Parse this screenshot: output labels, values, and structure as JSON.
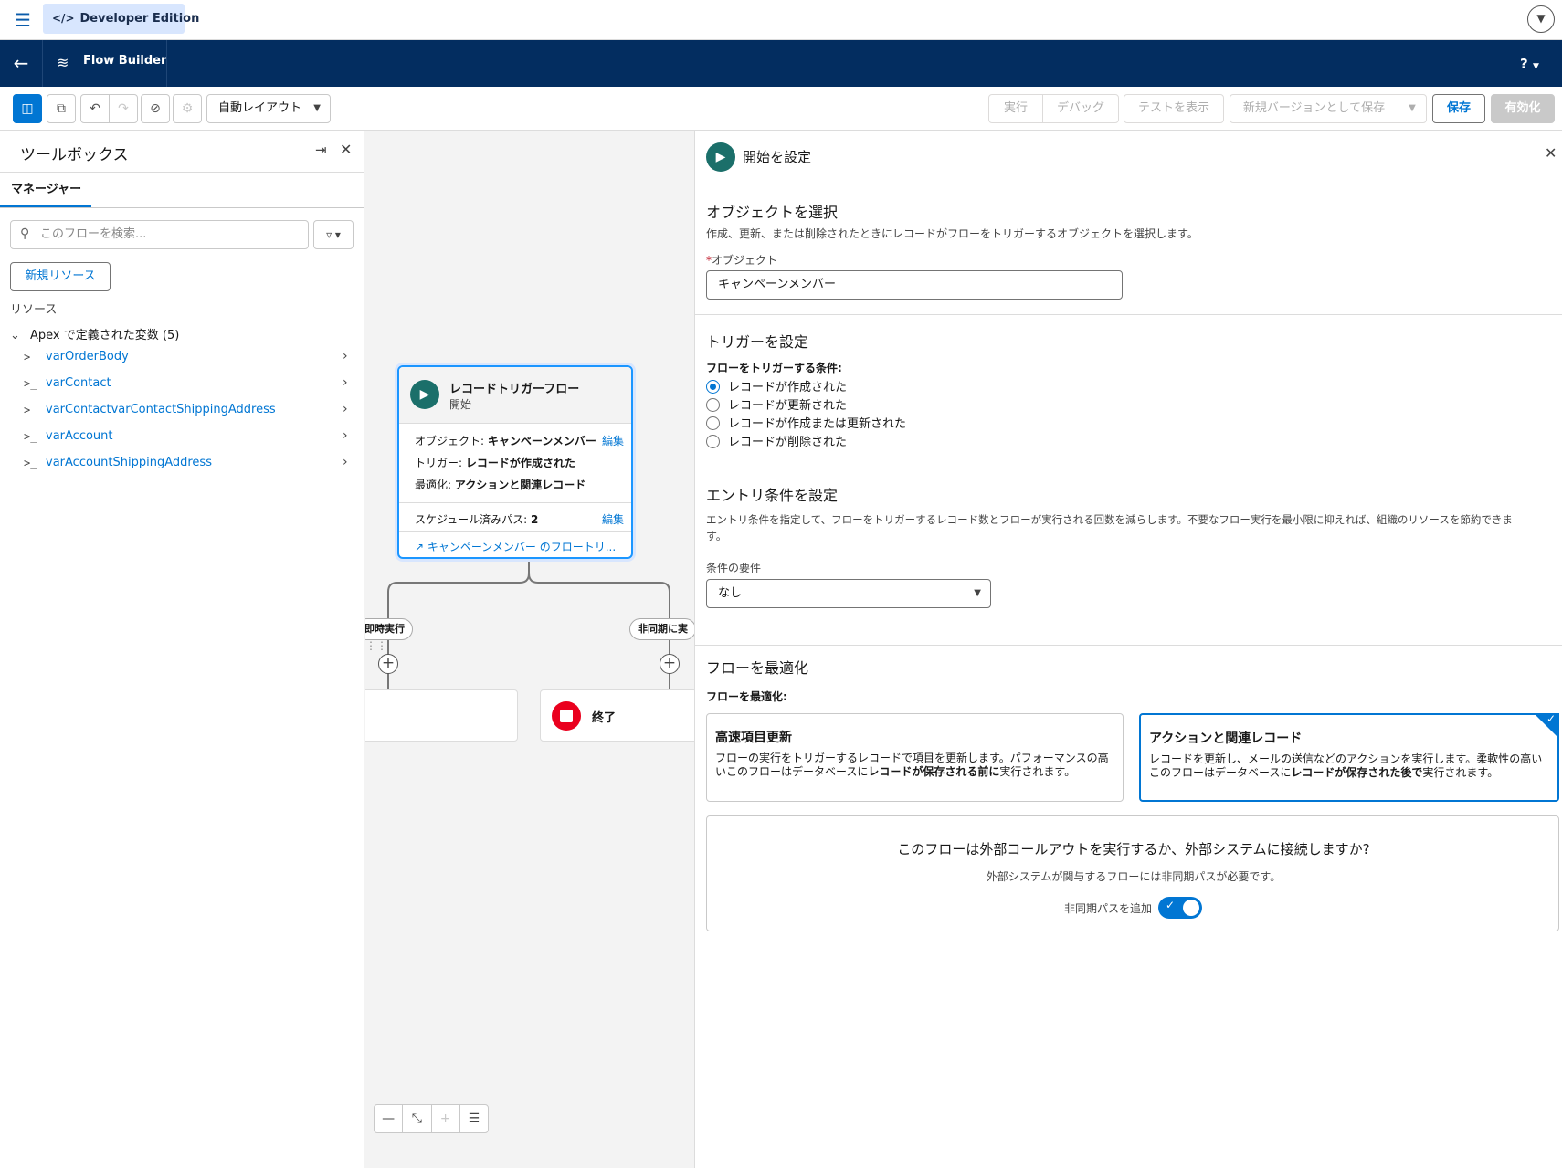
{
  "topbar": {
    "menu_icon": "hamburger-icon",
    "app_name": "Developer Edition",
    "app_icon": "code-icon",
    "user_icon": "chevron-down-icon"
  },
  "header": {
    "back_icon": "arrow-left-icon",
    "tool_icon": "flow-icon",
    "title": "Flow Builder",
    "help": "?"
  },
  "toolbar": {
    "layout_value": "自動レイアウト",
    "run": "実行",
    "debug": "デバッグ",
    "view_tests": "テストを表示",
    "save_as_new_version": "新規バージョンとして保存",
    "save": "保存",
    "activate": "有効化"
  },
  "toolbox": {
    "title": "ツールボックス",
    "tab": "マネージャー",
    "search_placeholder": "このフローを検索...",
    "new_resource": "新規リソース",
    "resources_label": "リソース",
    "group_label": "Apex で定義された変数 (5)",
    "variables": [
      {
        "name": "varOrderBody"
      },
      {
        "name": "varContact"
      },
      {
        "name": "varContactvarContactShippingAddress"
      },
      {
        "name": "varAccount"
      },
      {
        "name": "varAccountShippingAddress"
      }
    ]
  },
  "canvas": {
    "start": {
      "name": "レコードトリガーフロー",
      "sub": "開始",
      "object_label": "オブジェクト:",
      "object_value": "キャンペーンメンバー",
      "trigger_label": "トリガー:",
      "trigger_value": "レコードが作成された",
      "optimize_label": "最適化:",
      "optimize_value": "アクションと関連レコード",
      "edit": "編集",
      "scheduled_label": "スケジュール済みパス:",
      "scheduled_value": "2",
      "link": "キャンペーンメンバー のフロートリ..."
    },
    "path_immediate": "即時実行",
    "path_async": "非同期に実",
    "end_label": "終了"
  },
  "panel": {
    "title": "開始を設定",
    "object_section": {
      "title": "オブジェクトを選択",
      "desc": "作成、更新、または削除されたときにレコードがフローをトリガーするオブジェクトを選択します。",
      "field_label": "オブジェクト",
      "field_value": "キャンペーンメンバー"
    },
    "trigger_section": {
      "title": "トリガーを設定",
      "label": "フローをトリガーする条件:",
      "options": [
        {
          "label": "レコードが作成された"
        },
        {
          "label": "レコードが更新された"
        },
        {
          "label": "レコードが作成または更新された"
        },
        {
          "label": "レコードが削除された"
        }
      ],
      "selected_index": 0
    },
    "entry_section": {
      "title": "エントリ条件を設定",
      "desc_line1": "エントリ条件を指定して、フローをトリガーするレコード数とフローが実行される回数を減らします。不要なフロー実行を最小限に抑えれば、組織のリソースを節約できま",
      "desc_line2": "す。",
      "cond_label": "条件の要件",
      "cond_value": "なし"
    },
    "optimize_section": {
      "title": "フローを最適化",
      "label": "フローを最適化:",
      "fast": {
        "title": "高速項目更新",
        "desc_pre": "フローの実行をトリガーするレコードで項目を更新します。パフォーマンスの高いこのフローはデータベースに",
        "desc_bold": "レコードが保存される前に",
        "desc_post": "実行されます。"
      },
      "actions": {
        "title": "アクションと関連レコード",
        "desc_pre": "レコードを更新し、メールの送信などのアクションを実行します。柔軟性の高いこのフローはデータベースに",
        "desc_bold": "レコードが保存された後で",
        "desc_post": "実行されます。"
      }
    },
    "callout": {
      "question": "このフローは外部コールアウトを実行するか、外部システムに接続しますか?",
      "desc": "外部システムが関与するフローには非同期パスが必要です。",
      "toggle_label": "非同期パスを追加",
      "toggle_on": true
    }
  }
}
